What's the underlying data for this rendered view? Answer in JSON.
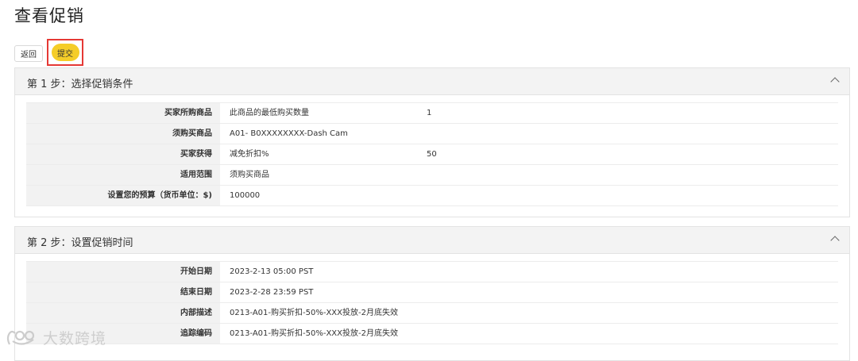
{
  "page": {
    "title": "查看促销"
  },
  "toolbar": {
    "back_label": "返回",
    "submit_label": "提交"
  },
  "step1": {
    "title": "第 1 步：选择促销条件",
    "rows": [
      {
        "label": "买家所购商品",
        "value": "此商品的最低购买数量",
        "extra": "1"
      },
      {
        "label": "须购买商品",
        "value": "A01- B0XXXXXXXX-Dash Cam",
        "extra": ""
      },
      {
        "label": "买家获得",
        "value": "减免折扣%",
        "extra": "50"
      },
      {
        "label": "适用范围",
        "value": "须购买商品",
        "extra": ""
      },
      {
        "label": "设置您的预算（货币单位：$)",
        "value": "100000",
        "extra": ""
      }
    ]
  },
  "step2": {
    "title": "第 2 步：设置促销时间",
    "rows": [
      {
        "label": "开始日期",
        "value": "2023-2-13  05:00  PST"
      },
      {
        "label": "结束日期",
        "value": "2023-2-28  23:59  PST"
      },
      {
        "label": "内部描述",
        "value": "0213-A01-购买折扣-50%-XXX投放-2月底失效"
      },
      {
        "label": "追踪编码",
        "value": "0213-A01-购买折扣-50%-XXX投放-2月底失效"
      }
    ]
  },
  "watermark": {
    "text": "大数跨境",
    "icon": "brand-logo-icon"
  },
  "colors": {
    "submit": "#f5cd28",
    "highlight": "#e53935",
    "label_bg": "#f2f2f2",
    "header_bg": "#f3f3f3"
  }
}
